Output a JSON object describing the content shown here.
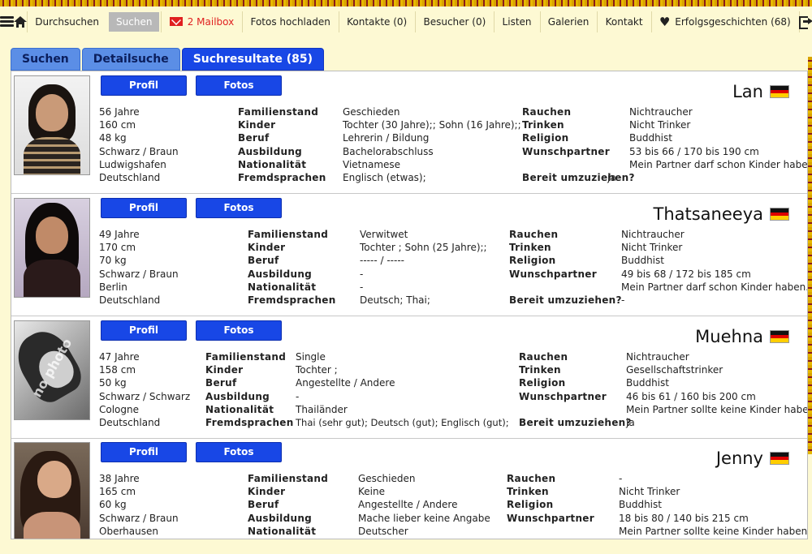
{
  "nav": {
    "items": [
      {
        "label": "Durchsuchen"
      },
      {
        "label": "Suchen",
        "active": true
      },
      {
        "label": "2 Mailbox"
      },
      {
        "label": "Fotos hochladen"
      },
      {
        "label": "Kontakte (0)"
      },
      {
        "label": "Besucher (0)"
      },
      {
        "label": "Listen"
      },
      {
        "label": "Galerien"
      },
      {
        "label": "Kontakt"
      },
      {
        "label": "Erfolgsgeschichten (68)"
      }
    ],
    "icons": [
      "menu-icon",
      "home-icon",
      "mail-icon",
      "heart-icon",
      "logout-icon"
    ]
  },
  "tabs": [
    {
      "label": "Suchen"
    },
    {
      "label": "Detailsuche"
    },
    {
      "label": "Suchresultate (85)",
      "active": true
    }
  ],
  "buttons": {
    "profil": "Profil",
    "fotos": "Fotos"
  },
  "labels": {
    "familienstand": "Familienstand",
    "kinder": "Kinder",
    "beruf": "Beruf",
    "ausbildung": "Ausbildung",
    "nationalitaet": "Nationalität",
    "fremdsprachen": "Fremdsprachen",
    "rauchen": "Rauchen",
    "trinken": "Trinken",
    "religion": "Religion",
    "wunschpartner": "Wunschpartner",
    "umziehen": "Bereit umzuziehen?"
  },
  "profiles": [
    {
      "name": "Lan",
      "basic": [
        "56 Jahre",
        "160 cm",
        "48 kg",
        "Schwarz / Braun",
        "Ludwigshafen",
        "Deutschland"
      ],
      "familienstand": "Geschieden",
      "kinder": "Tochter (30 Jahre);; Sohn (16 Jahre);;",
      "beruf": "Lehrerin / Bildung",
      "ausbildung": "Bachelorabschluss",
      "nationalitaet": "Vietnamese",
      "fremdsprachen": "Englisch (etwas);",
      "rauchen": "Nichtraucher",
      "trinken": "Nicht Trinker",
      "religion": "Buddhist",
      "wunschpartner": "53 bis 66  / 170 bis 190 cm",
      "kinderwunsch": "Mein Partner darf schon Kinder haben.",
      "umziehen": "ja"
    },
    {
      "name": "Thatsaneeya",
      "basic": [
        "49 Jahre",
        "170 cm",
        "70 kg",
        "Schwarz / Braun",
        "Berlin",
        "Deutschland"
      ],
      "familienstand": "Verwitwet",
      "kinder": "Tochter ; Sohn (25 Jahre);;",
      "beruf": "----- / -----",
      "ausbildung": "-",
      "nationalitaet": "-",
      "fremdsprachen": "Deutsch;  Thai;",
      "rauchen": "Nichtraucher",
      "trinken": "Nicht Trinker",
      "religion": "Buddhist",
      "wunschpartner": "49 bis 68  / 172 bis 185 cm",
      "kinderwunsch": "Mein Partner darf schon Kinder haben.",
      "umziehen": "-"
    },
    {
      "name": "Muehna",
      "basic": [
        "47 Jahre",
        "158 cm",
        "50 kg",
        "Schwarz / Schwarz",
        "Cologne",
        "Deutschland"
      ],
      "familienstand": "Single",
      "kinder": "Tochter ;",
      "beruf": "Angestellte / Andere",
      "ausbildung": "-",
      "nationalitaet": "Thailänder",
      "fremdsprachen": "Thai (sehr gut);  Deutsch (gut);  Englisch (gut);",
      "rauchen": "Nichtraucher",
      "trinken": "Gesellschaftstrinker",
      "religion": "Buddhist",
      "wunschpartner": "46 bis 61  / 160 bis 200 cm",
      "kinderwunsch": "Mein Partner sollte keine Kinder haben.",
      "umziehen": "ja",
      "photo_text": "no photo"
    },
    {
      "name": "Jenny",
      "basic": [
        "38 Jahre",
        "165 cm",
        "60 kg",
        "Schwarz / Braun",
        "Oberhausen",
        ""
      ],
      "familienstand": "Geschieden",
      "kinder": "Keine",
      "beruf": "Angestellte / Andere",
      "ausbildung": "Mache lieber keine Angabe",
      "nationalitaet": "Deutscher",
      "fremdsprachen": "",
      "rauchen": "-",
      "trinken": "Nicht Trinker",
      "religion": "Buddhist",
      "wunschpartner": "18 bis 80  / 140 bis 215 cm",
      "kinderwunsch": "Mein Partner sollte keine Kinder haben.",
      "umziehen": ""
    }
  ],
  "colors": {
    "accent": "#1847e6",
    "tab_inactive": "#5b8ee6",
    "background": "#fdf9d3",
    "mail": "#e02020"
  }
}
